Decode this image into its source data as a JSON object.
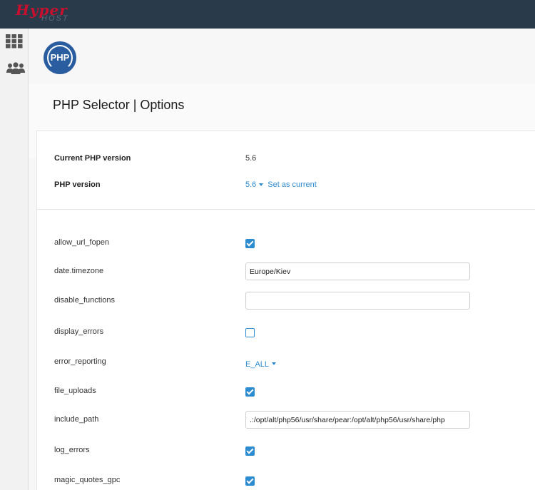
{
  "brand": {
    "name": "Hyper",
    "sub": "HOST"
  },
  "sidebar": {
    "items": [
      {
        "icon": "apps-grid-icon"
      },
      {
        "icon": "users-icon"
      }
    ]
  },
  "header": {
    "logo_text": "PHP"
  },
  "page": {
    "title": "PHP Selector | Options"
  },
  "versions": {
    "current_label": "Current PHP version",
    "current_value": "5.6",
    "php_label": "PHP version",
    "php_value": "5.6",
    "set_current": "Set as current"
  },
  "options": {
    "allow_url_fopen": {
      "label": "allow_url_fopen",
      "checked": true
    },
    "date_timezone": {
      "label": "date.timezone",
      "value": "Europe/Kiev"
    },
    "disable_functions": {
      "label": "disable_functions",
      "value": ""
    },
    "display_errors": {
      "label": "display_errors",
      "checked": false
    },
    "error_reporting": {
      "label": "error_reporting",
      "value": "E_ALL"
    },
    "file_uploads": {
      "label": "file_uploads",
      "checked": true
    },
    "include_path": {
      "label": "include_path",
      "value": ".:/opt/alt/php56/usr/share/pear:/opt/alt/php56/usr/share/php"
    },
    "log_errors": {
      "label": "log_errors",
      "checked": true
    },
    "magic_quotes_gpc": {
      "label": "magic_quotes_gpc",
      "checked": true
    }
  },
  "colors": {
    "topbar": "#293a4a",
    "accent": "#2d8bd0",
    "brand_red": "#c8102e",
    "php_blue": "#2a5d9f"
  }
}
